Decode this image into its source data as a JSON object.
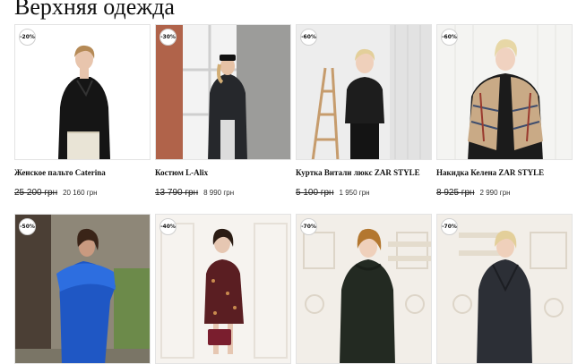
{
  "page": {
    "title": "Верхняя одежда"
  },
  "products": [
    {
      "badge": "-20%",
      "name": "Женское пальто Caterina",
      "old_price": "25 200 грн",
      "new_price": "20 160 грн"
    },
    {
      "badge": "-30%",
      "name": "Костюм L-Alix",
      "old_price": "13 790 грн",
      "new_price": "8 990 грн"
    },
    {
      "badge": "-60%",
      "name": "Куртка Витали люкс ZAR STYLE",
      "old_price": "5 100 грн",
      "new_price": "1 950 грн"
    },
    {
      "badge": "-60%",
      "name": "Накидка Келена ZAR STYLE",
      "old_price": "8 925 грн",
      "new_price": "2 990 грн"
    },
    {
      "badge": "-50%"
    },
    {
      "badge": "-40%"
    },
    {
      "badge": "-70%"
    },
    {
      "badge": "-70%"
    }
  ]
}
